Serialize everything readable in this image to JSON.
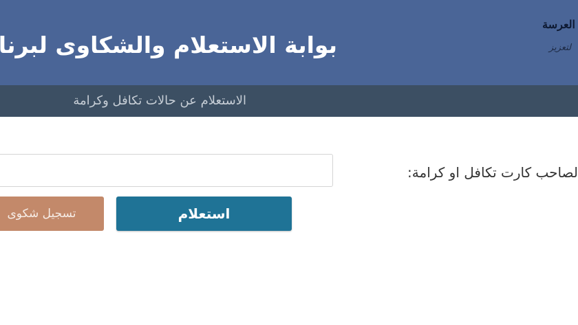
{
  "header": {
    "title": "بوابة الاستعلام والشكاوى لبرنامج",
    "org_name": "العرسة",
    "org_subtitle": "لتعزيز",
    "background_color": "#4a6597"
  },
  "navbar": {
    "link_label": "الاستعلام عن حالات تكافل وكرامة",
    "background_color": "#3c4f63"
  },
  "form": {
    "field_label": "لصاحب كارت تكافل او كرامة:",
    "input_value": "",
    "input_placeholder": ""
  },
  "buttons": {
    "inquiry_label": "استعلام",
    "inquiry_color": "#1f7396",
    "complaint_label": "تسجيل شكوى",
    "complaint_color": "#c3896a"
  }
}
